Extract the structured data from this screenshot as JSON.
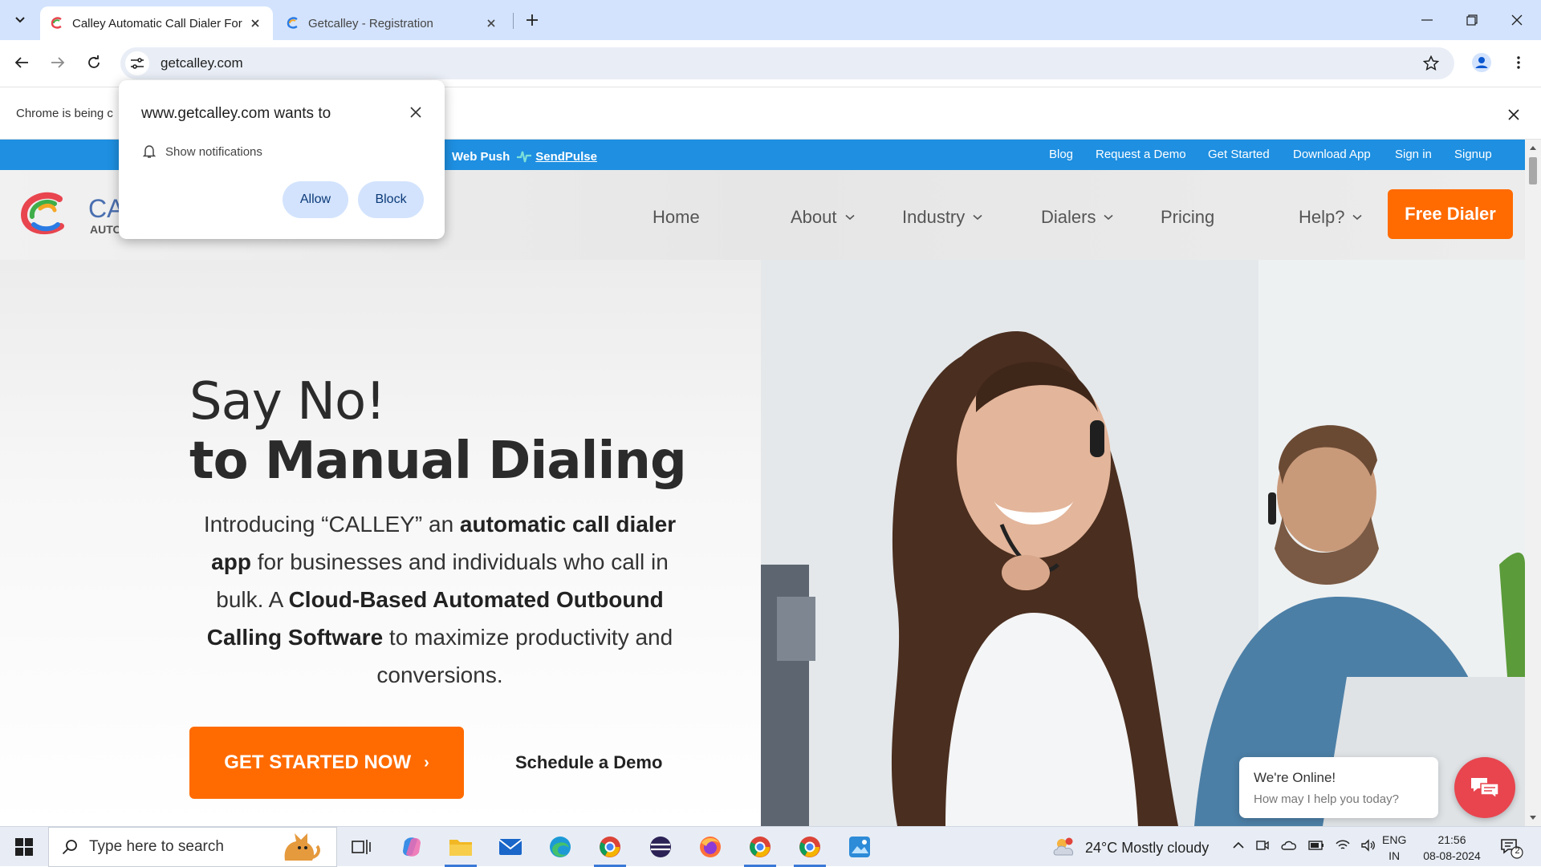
{
  "browser": {
    "tabs": [
      {
        "title": "Calley Automatic Call Dialer For",
        "active": true
      },
      {
        "title": "Getcalley - Registration",
        "active": false
      }
    ],
    "url": "getcalley.com",
    "managed_message": "Chrome is being c"
  },
  "permission_popup": {
    "title": "www.getcalley.com wants to",
    "permission": "Show notifications",
    "allow_label": "Allow",
    "block_label": "Block"
  },
  "site": {
    "topbar": {
      "webpush_label": "Web Push",
      "sendpulse_label": "SendPulse",
      "links": [
        "Blog",
        "Request a Demo",
        "Get Started",
        "Download App",
        "Sign in",
        "Signup"
      ]
    },
    "logo": {
      "text": "CA",
      "subtext": "AUTO"
    },
    "nav": {
      "home": "Home",
      "about": "About",
      "industry": "Industry",
      "dialers": "Dialers",
      "pricing": "Pricing",
      "help": "Help?",
      "free_dialer": "Free Dialer"
    },
    "hero": {
      "line1": "Say No!",
      "line2_prefix": "to ",
      "line2_bold": "Manual Dialing",
      "intro_1": "Introducing “CALLEY” an ",
      "intro_2": "automatic call dialer app",
      "intro_3": " for businesses and individuals who call in bulk. A ",
      "intro_4": "Cloud-Based Automated Outbound Calling Software",
      "intro_5": " to maximize productivity and conversions.",
      "cta_label": "GET STARTED NOW",
      "cta_arrow": "›",
      "demo_label": "Schedule a Demo"
    },
    "chat": {
      "status": "We're Online!",
      "prompt": "How may I help you today?"
    }
  },
  "taskbar": {
    "search_placeholder": "Type here to search",
    "weather": "24°C  Mostly cloudy",
    "lang_1": "ENG",
    "lang_2": "IN",
    "time": "21:56",
    "date": "08-08-2024",
    "notif_count": "2"
  },
  "colors": {
    "accent_orange": "#ff6b00",
    "topbar_blue": "#1e8fe1",
    "chat_red": "#e8454f",
    "chrome_tabstrip": "#d3e3fd"
  }
}
